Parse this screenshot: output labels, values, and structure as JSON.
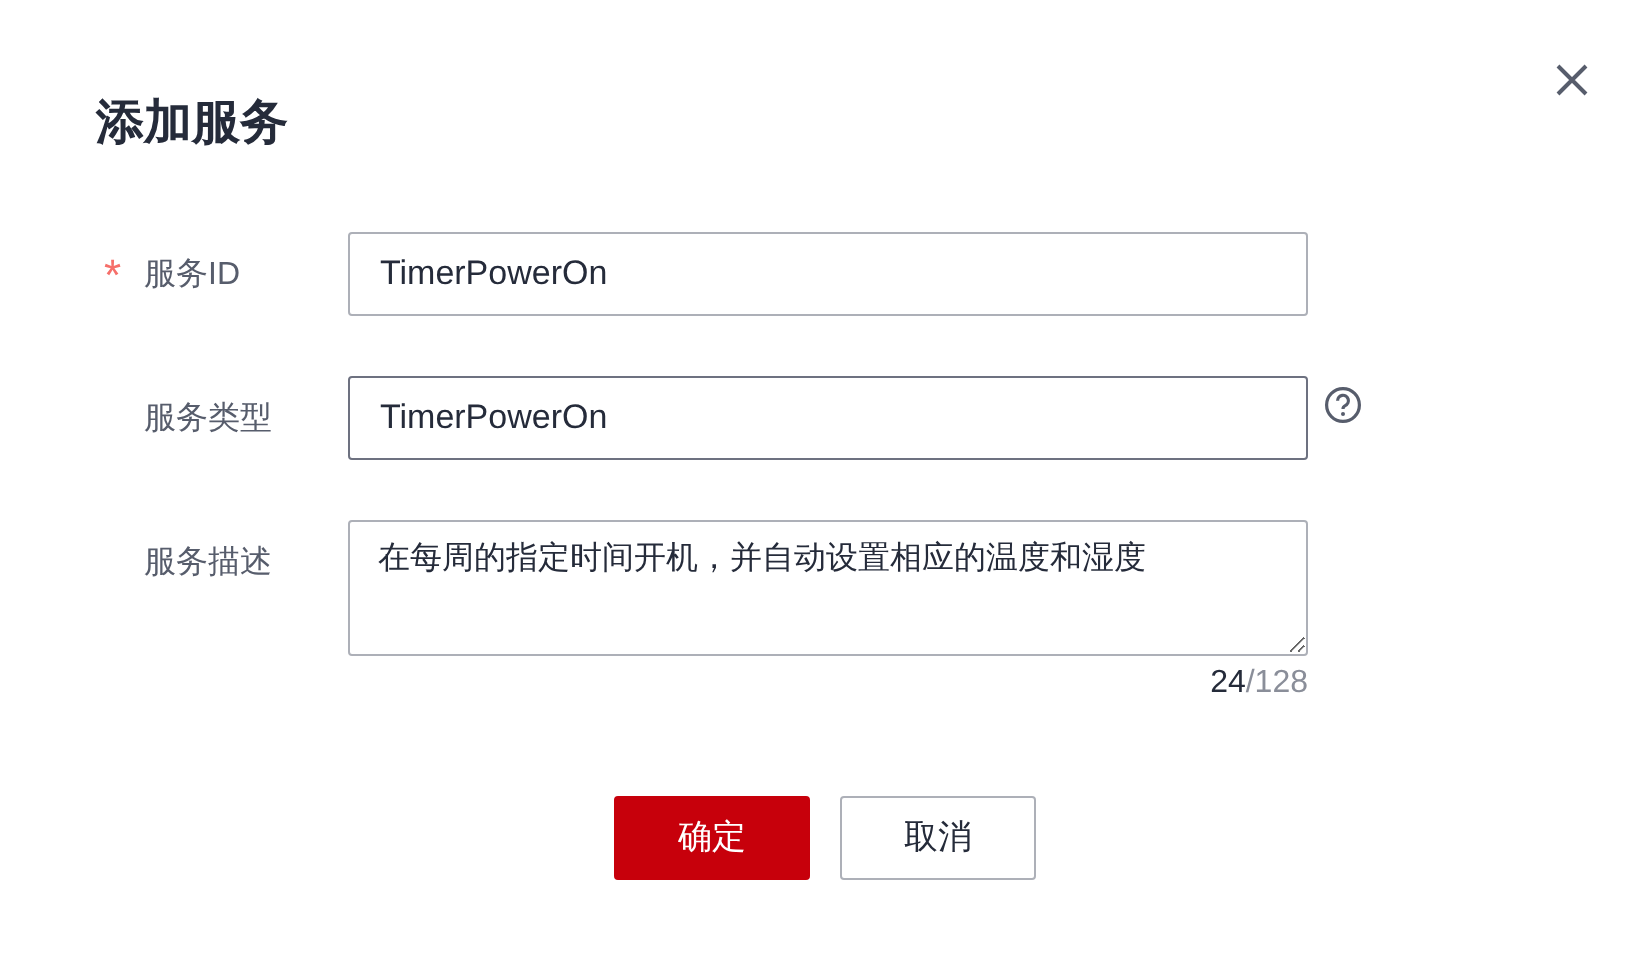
{
  "dialog": {
    "title": "添加服务",
    "fields": [
      {
        "kind": "input",
        "label": "服务ID",
        "required": true,
        "focused": false,
        "value": "TimerPowerOn",
        "help": false
      },
      {
        "kind": "input",
        "label": "服务类型",
        "required": false,
        "focused": true,
        "value": "TimerPowerOn",
        "help": true
      },
      {
        "kind": "textarea",
        "label": "服务描述",
        "required": false,
        "focused": false,
        "value": "在每周的指定时间开机，并自动设置相应的温度和湿度",
        "count": "24",
        "max": "/128",
        "help": false
      }
    ],
    "required_mark": "*",
    "buttons": [
      {
        "label": "确定",
        "primary": true
      },
      {
        "label": "取消",
        "primary": false
      }
    ]
  }
}
